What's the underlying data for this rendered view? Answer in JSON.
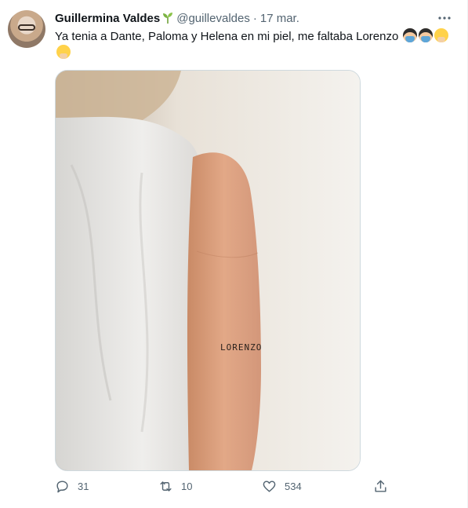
{
  "tweet": {
    "author_name": "Guillermina Valdes",
    "handle": "@guillevaldes",
    "separator": "·",
    "date": "17 mar.",
    "text": "Ya tenia a Dante, Paloma y Helena en mi piel, me faltaba Lorenzo",
    "name_emoji": "seedling-icon",
    "trailing_emojis": [
      "person-gesturing-no-icon",
      "person-gesturing-no-icon",
      "person-gesturing-no-icon",
      "person-gesturing-no-icon"
    ],
    "media": {
      "tattoo_text": "LORENZO"
    }
  },
  "actions": {
    "replies": "31",
    "retweets": "10",
    "likes": "534"
  },
  "colors": {
    "text_primary": "#0f1419",
    "text_secondary": "#536471",
    "border": "#cfd9de",
    "sprout_green": "#6fa13a"
  }
}
